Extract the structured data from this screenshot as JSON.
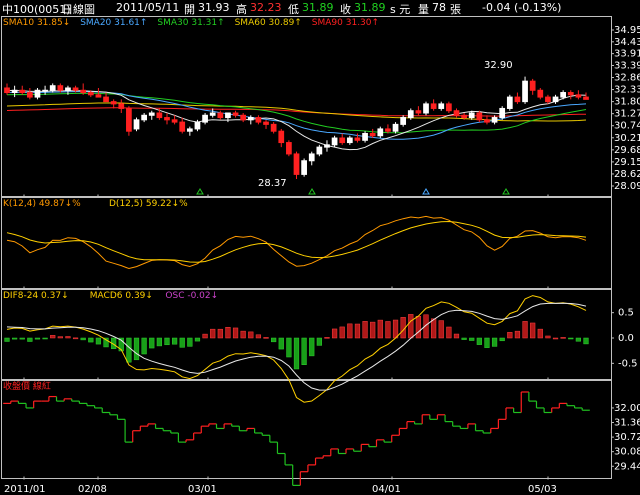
{
  "header": {
    "symbol": "中100(0051)",
    "period": "日線圖",
    "date": "2011/05/11",
    "open_label": "開",
    "open": "31.93",
    "high_label": "高",
    "high": "32.23",
    "low_label": "低",
    "low": "31.89",
    "close_label": "收",
    "close": "31.89",
    "unit": "s 元",
    "vol_label": "量",
    "volume": "78",
    "vol_unit": "張",
    "change": "-0.04 (-0.13%)"
  },
  "colors": {
    "up": "#ff2020",
    "down": "#20c020",
    "text_yellow": "#ffd000",
    "sma10": "#e8e8e8",
    "sma20": "#4aa8ff",
    "sma30": "#22cc22",
    "sma60": "#e8c800",
    "sma90": "#ff2020",
    "k": "#ff9900",
    "d": "#ffd000",
    "dif": "#ffd000",
    "macd": "#e8e8e8",
    "osc": "#cc44cc"
  },
  "price_panel": {
    "legend": [
      {
        "text": "SMA10 31.85↓",
        "color": "#ff9900"
      },
      {
        "text": "SMA20 31.61↑",
        "color": "#4aa8ff"
      },
      {
        "text": "SMA30 31.31↑",
        "color": "#22cc22"
      },
      {
        "text": "SMA60 30.89↑",
        "color": "#e8c800"
      },
      {
        "text": "SMA90 31.30↑",
        "color": "#ff2020"
      }
    ],
    "y_ticks": [
      "34.95",
      "34.43",
      "33.91",
      "33.39",
      "32.86",
      "32.33",
      "31.80",
      "31.27",
      "30.74",
      "30.21",
      "29.68",
      "29.15",
      "28.62",
      "28.09"
    ],
    "high_annotation": "32.90",
    "low_annotation": "28.37"
  },
  "kd_panel": {
    "legend": [
      {
        "text": "K(12,4) 49.87↓%",
        "color": "#ff9900"
      },
      {
        "text": "D(12,5) 59.22↓%",
        "color": "#ffd000"
      }
    ]
  },
  "macd_panel": {
    "legend": [
      {
        "text": "DIF8-24 0.37↓",
        "color": "#ffd000"
      },
      {
        "text": "MACD6 0.39↓",
        "color": "#ffd000"
      },
      {
        "text": "OSC -0.02↓",
        "color": "#cc44cc"
      }
    ],
    "y_ticks": [
      "0.5",
      "0.0",
      "-0.5"
    ]
  },
  "close_panel": {
    "legend": [
      {
        "text": "收盤價 線紅",
        "color": "#ff2020"
      }
    ],
    "y_ticks": [
      "32.00",
      "31.36",
      "30.72",
      "30.08",
      "29.44"
    ]
  },
  "x_axis": {
    "labels": [
      "2011/01",
      "02/08",
      "03/01",
      "04/01",
      "05/03"
    ]
  },
  "chart_data": {
    "type": "line",
    "title": "中100(0051) 日線圖",
    "x_labels": [
      "2011/01",
      "02/08",
      "03/01",
      "04/01",
      "05/03"
    ],
    "candles": [
      [
        32.4,
        32.6,
        32.1,
        32.2
      ],
      [
        32.2,
        32.5,
        32.0,
        32.3
      ],
      [
        32.3,
        32.5,
        32.1,
        32.2
      ],
      [
        32.2,
        32.4,
        31.9,
        32.0
      ],
      [
        32.0,
        32.4,
        31.9,
        32.3
      ],
      [
        32.3,
        32.5,
        32.1,
        32.3
      ],
      [
        32.3,
        32.6,
        32.2,
        32.5
      ],
      [
        32.5,
        32.6,
        32.2,
        32.3
      ],
      [
        32.3,
        32.5,
        32.1,
        32.4
      ],
      [
        32.4,
        32.5,
        32.2,
        32.3
      ],
      [
        32.3,
        32.6,
        32.1,
        32.2
      ],
      [
        32.2,
        32.3,
        32.0,
        32.1
      ],
      [
        32.1,
        32.4,
        32.0,
        32.0
      ],
      [
        32.0,
        32.2,
        31.8,
        31.8
      ],
      [
        31.8,
        31.9,
        31.5,
        31.7
      ],
      [
        31.7,
        31.9,
        31.3,
        31.5
      ],
      [
        31.5,
        31.6,
        30.3,
        30.5
      ],
      [
        30.6,
        31.1,
        30.5,
        31.0
      ],
      [
        31.0,
        31.3,
        30.9,
        31.2
      ],
      [
        31.2,
        31.4,
        31.0,
        31.3
      ],
      [
        31.3,
        31.5,
        31.0,
        31.1
      ],
      [
        31.1,
        31.3,
        30.8,
        31.0
      ],
      [
        31.0,
        31.2,
        30.8,
        30.9
      ],
      [
        30.9,
        31.1,
        30.4,
        30.5
      ],
      [
        30.5,
        30.7,
        30.3,
        30.6
      ],
      [
        30.6,
        31.0,
        30.5,
        30.9
      ],
      [
        30.9,
        31.3,
        30.8,
        31.2
      ],
      [
        31.2,
        31.5,
        31.1,
        31.3
      ],
      [
        31.3,
        31.4,
        31.0,
        31.1
      ],
      [
        31.1,
        31.3,
        30.9,
        31.3
      ],
      [
        31.3,
        31.4,
        31.1,
        31.2
      ],
      [
        31.2,
        31.3,
        30.9,
        31.0
      ],
      [
        31.0,
        31.2,
        30.8,
        31.1
      ],
      [
        31.1,
        31.2,
        30.8,
        30.9
      ],
      [
        30.9,
        31.0,
        30.6,
        30.8
      ],
      [
        30.8,
        30.9,
        30.4,
        30.5
      ],
      [
        30.5,
        30.6,
        29.8,
        30.0
      ],
      [
        30.0,
        30.1,
        29.4,
        29.5
      ],
      [
        29.5,
        29.6,
        28.4,
        28.6
      ],
      [
        28.6,
        29.3,
        28.5,
        29.2
      ],
      [
        29.2,
        29.6,
        29.0,
        29.5
      ],
      [
        29.5,
        29.9,
        29.4,
        29.8
      ],
      [
        29.8,
        30.1,
        29.6,
        29.9
      ],
      [
        29.9,
        30.3,
        29.8,
        30.2
      ],
      [
        30.2,
        30.4,
        29.9,
        30.0
      ],
      [
        30.0,
        30.3,
        29.9,
        30.2
      ],
      [
        30.2,
        30.4,
        30.0,
        30.1
      ],
      [
        30.1,
        30.5,
        30.0,
        30.4
      ],
      [
        30.4,
        30.6,
        30.2,
        30.3
      ],
      [
        30.3,
        30.7,
        30.2,
        30.6
      ],
      [
        30.6,
        30.8,
        30.4,
        30.5
      ],
      [
        30.5,
        30.9,
        30.4,
        30.8
      ],
      [
        30.8,
        31.2,
        30.7,
        31.1
      ],
      [
        31.1,
        31.5,
        31.0,
        31.4
      ],
      [
        31.4,
        31.6,
        31.2,
        31.3
      ],
      [
        31.3,
        31.8,
        31.2,
        31.7
      ],
      [
        31.7,
        31.9,
        31.4,
        31.5
      ],
      [
        31.5,
        31.8,
        31.4,
        31.7
      ],
      [
        31.7,
        31.8,
        31.3,
        31.4
      ],
      [
        31.4,
        31.5,
        31.1,
        31.2
      ],
      [
        31.2,
        31.3,
        31.0,
        31.1
      ],
      [
        31.1,
        31.4,
        31.0,
        31.3
      ],
      [
        31.3,
        31.4,
        30.9,
        31.0
      ],
      [
        31.0,
        31.2,
        30.8,
        30.9
      ],
      [
        30.9,
        31.2,
        30.8,
        31.1
      ],
      [
        31.1,
        31.6,
        31.0,
        31.5
      ],
      [
        31.5,
        32.1,
        31.4,
        32.0
      ],
      [
        32.0,
        32.2,
        31.7,
        31.8
      ],
      [
        31.8,
        32.9,
        31.7,
        32.7
      ],
      [
        32.7,
        32.8,
        32.1,
        32.3
      ],
      [
        32.3,
        32.4,
        31.9,
        32.0
      ],
      [
        32.0,
        32.1,
        31.7,
        31.8
      ],
      [
        31.8,
        32.1,
        31.7,
        32.0
      ],
      [
        32.0,
        32.3,
        31.9,
        32.2
      ],
      [
        32.2,
        32.3,
        31.9,
        32.1
      ],
      [
        32.1,
        32.3,
        31.9,
        32.0
      ],
      [
        32.0,
        32.2,
        31.9,
        31.9
      ]
    ],
    "series": [
      {
        "name": "SMA10",
        "last": 31.85
      },
      {
        "name": "SMA20",
        "last": 31.61
      },
      {
        "name": "SMA30",
        "last": 31.31
      },
      {
        "name": "SMA60",
        "last": 30.89
      },
      {
        "name": "SMA90",
        "last": 31.3
      },
      {
        "name": "K(12,4)",
        "last": 49.87
      },
      {
        "name": "D(12,5)",
        "last": 59.22
      },
      {
        "name": "DIF8-24",
        "last": 0.37
      },
      {
        "name": "MACD6",
        "last": 0.39
      },
      {
        "name": "OSC",
        "last": -0.02
      }
    ],
    "ylim": [
      28.09,
      34.95
    ],
    "grid": false
  }
}
